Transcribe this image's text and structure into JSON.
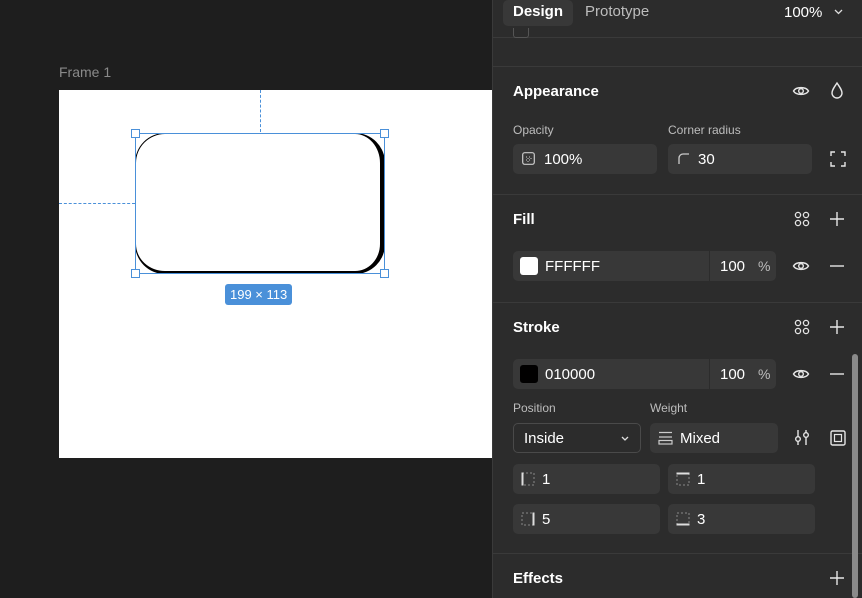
{
  "canvas": {
    "frame_label": "Frame 1",
    "dimensions": "199 × 113"
  },
  "tabs": {
    "design": "Design",
    "prototype": "Prototype",
    "zoom": "100%"
  },
  "appearance": {
    "title": "Appearance",
    "opacity_label": "Opacity",
    "opacity_value": "100%",
    "corner_radius_label": "Corner radius",
    "corner_radius_value": "30"
  },
  "fill": {
    "title": "Fill",
    "hex": "FFFFFF",
    "swatch_color": "#FFFFFF",
    "opacity": "100",
    "unit": "%"
  },
  "stroke": {
    "title": "Stroke",
    "hex": "010000",
    "swatch_color": "#010000",
    "opacity": "100",
    "unit": "%",
    "position_label": "Position",
    "position_value": "Inside",
    "weight_label": "Weight",
    "weight_value": "Mixed",
    "left": "1",
    "top": "1",
    "right": "5",
    "bottom": "3"
  },
  "effects": {
    "title": "Effects"
  },
  "colors": {
    "selection": "#4a90d9",
    "panel_bg": "#2c2c2c",
    "field_bg": "#383838"
  }
}
